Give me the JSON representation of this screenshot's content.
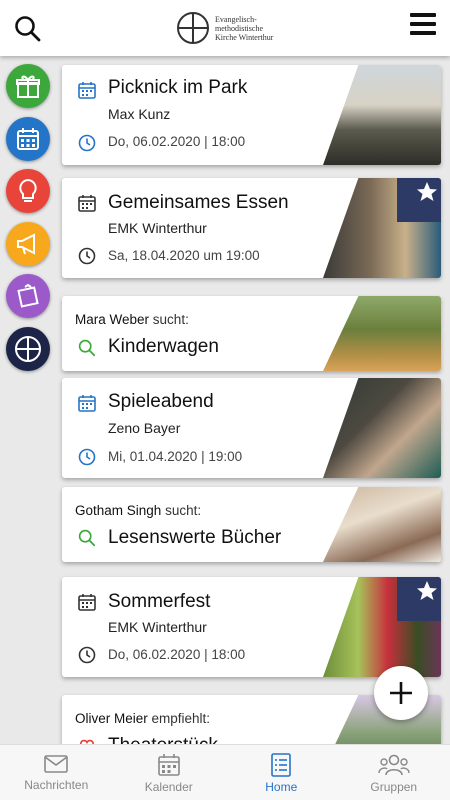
{
  "header": {
    "logo_text": "Evangelisch-methodistische Kirche Winterthur"
  },
  "categories": [
    {
      "name": "gift",
      "color": "#3ca83c"
    },
    {
      "name": "calendar",
      "color": "#2474c8"
    },
    {
      "name": "idea",
      "color": "#e8443a"
    },
    {
      "name": "announcement",
      "color": "#f7a81c"
    },
    {
      "name": "note",
      "color": "#9b59c9"
    },
    {
      "name": "church",
      "color": "#1c2547"
    }
  ],
  "feed": {
    "cards": [
      {
        "kind": "event",
        "title": "Picknick im Park",
        "subtitle": "Max Kunz",
        "date": "Do, 06.02.2020 | 18:00",
        "icon_color": "#2474c8",
        "starred": false
      },
      {
        "kind": "event",
        "title": "Gemeinsames Essen",
        "subtitle": "EMK Winterthur",
        "date": "Sa, 18.04.2020 um 19:00",
        "icon_color": "#333",
        "starred": true
      },
      {
        "kind": "search",
        "person": "Mara Weber",
        "verb": "sucht:",
        "title": "Kinderwagen"
      },
      {
        "kind": "event",
        "title": "Spieleabend",
        "subtitle": "Zeno Bayer",
        "date": "Mi, 01.04.2020 | 19:00",
        "icon_color": "#2474c8",
        "starred": false
      },
      {
        "kind": "search",
        "person": "Gotham Singh",
        "verb": "sucht:",
        "title": "Lesenswerte Bücher"
      },
      {
        "kind": "event",
        "title": "Sommerfest",
        "subtitle": "EMK Winterthur",
        "date": "Do, 06.02.2020 | 18:00",
        "icon_color": "#333",
        "starred": true
      },
      {
        "kind": "recommend",
        "person": "Oliver Meier",
        "verb": "empfiehlt:",
        "title": "Theaterstück"
      }
    ]
  },
  "nav": {
    "tabs": [
      {
        "label": "Nachrichten",
        "icon": "mail-icon",
        "active": false
      },
      {
        "label": "Kalender",
        "icon": "calendar-icon",
        "active": false
      },
      {
        "label": "Home",
        "icon": "list-icon",
        "active": true
      },
      {
        "label": "Gruppen",
        "icon": "groups-icon",
        "active": false
      }
    ]
  }
}
